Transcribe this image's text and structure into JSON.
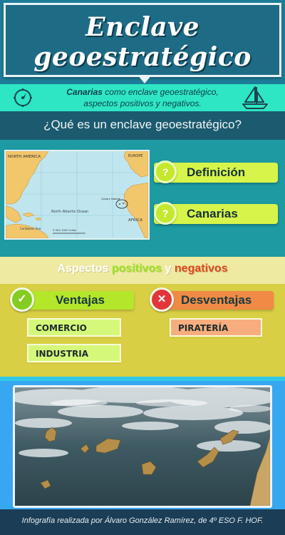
{
  "header": {
    "title_line1": "Enclave",
    "title_line2": "geoestratégico"
  },
  "subtitle": {
    "bold": "Canarias",
    "rest_line1": " como enclave geoestratégico,",
    "line2": "aspectos positivos y negativos."
  },
  "question": "¿Qué es un enclave geoestratégico?",
  "map": {
    "labels": {
      "north_america": "NORTH AMERICA",
      "ocean": "North Atlantic Ocean",
      "africa": "AFRICA",
      "europe": "EUROPE",
      "canary": "Canary Islands",
      "caribbean": "Caribbean Sea",
      "scale": "0  500  1000 miles"
    }
  },
  "buttons": {
    "q_mark": "?",
    "definicion": "Definición",
    "canarias": "Canarias"
  },
  "aspects": {
    "prefix": "Aspectos ",
    "positivos": "positivos",
    "middle": " y ",
    "negativos": "negativos"
  },
  "ventajas": {
    "title": "Ventajas",
    "icon": "✓",
    "items": [
      "COMERCIO",
      "INDUSTRIA"
    ]
  },
  "desventajas": {
    "title": "Desventajas",
    "icon": "✕",
    "items": [
      "PIRATERÍA"
    ]
  },
  "footer": "Infografía realizada por Álvaro González Ramírez, de 4º ESO F. HOF.",
  "colors": {
    "positivos": "#9be21f",
    "negativos": "#e0471e"
  }
}
